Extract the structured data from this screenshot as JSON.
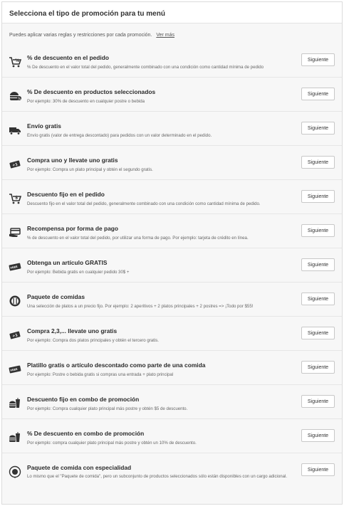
{
  "header": {
    "title": "Selecciona el tipo de promoción para tu menú"
  },
  "intro": {
    "text": "Puedes aplicar varias reglas y restricciones por cada promoción.",
    "link": "Ver más"
  },
  "button_label": "Siguiente",
  "promotions": [
    {
      "icon": "cart-percent-icon",
      "title": "% de descuento en el pedido",
      "description": "% De descuento en el valor total del pedido, generalmente combinado con una condición como cantidad mínima de pedido"
    },
    {
      "icon": "burger-percent-icon",
      "title": "% De descuento en productos seleccionados",
      "description": "Por ejemplo: 30% de descuento en cualquier postre o bebida"
    },
    {
      "icon": "delivery-truck-icon",
      "title": "Envío gratis",
      "description": "Envío gratis (valor de entrega descontado) para pedidos con un valor determinado en el pedido."
    },
    {
      "icon": "plus-one-ticket-icon",
      "title": "Compra uno y llevate uno gratis",
      "description": "Por ejemplo: Compra un plato principal y obtén el segundo gratis."
    },
    {
      "icon": "cart-dollar-icon",
      "title": "Descuento fijo en el pedido",
      "description": "Descuento fijo en el valor total del pedido, generalmente combinado con una condición como cantidad mínima de pedido."
    },
    {
      "icon": "card-hand-icon",
      "title": "Recompensa por forma de pago",
      "description": "% de descuento en el valor total del pedido, por utilizar una forma de pago. Por ejemplo: tarjeta de crédito en línea."
    },
    {
      "icon": "free-ticket-icon",
      "title": "Obtenga un artículo GRATIS",
      "description": "Por ejemplo: Bebida gratis en cualquier pedido 30$ +"
    },
    {
      "icon": "plate-cutlery-icon",
      "title": "Paquete de comidas",
      "description": "Una selección de platos a un precio fijo. Por ejemplo: 2 aperitivos + 2 platos principales + 2 postres => ¡Todo por $55!"
    },
    {
      "icon": "plus-one-ticket-icon",
      "title": "Compra 2,3,... llevate uno gratis",
      "description": "Por ejemplo: Compra dos platos principales y obtén el tercero gratis."
    },
    {
      "icon": "free-ticket-icon",
      "title": "Platillo gratis o artículo descontado como parte de una comida",
      "description": "Por ejemplo: Postre o bebida gratis si compras una entrada + plato principal"
    },
    {
      "icon": "combo-drink-icon",
      "title": "Descuento fijo en combo de promoción",
      "description": "Por ejemplo: Compra cualquier plato principal más postre y obtén $5 de descuento."
    },
    {
      "icon": "combo-drink-icon",
      "title": "% De descuento en combo de promoción",
      "description": "Por ejemplo: compra cualquier plato principal más postre y obtén un 10% de descuento."
    },
    {
      "icon": "special-meal-icon",
      "title": "Paquete de comida con especialidad",
      "description": "Lo mismo que el \"Paquete de comida\", pero un subconjunto de productos seleccionados sólo están disponibles con un cargo adicional."
    }
  ]
}
